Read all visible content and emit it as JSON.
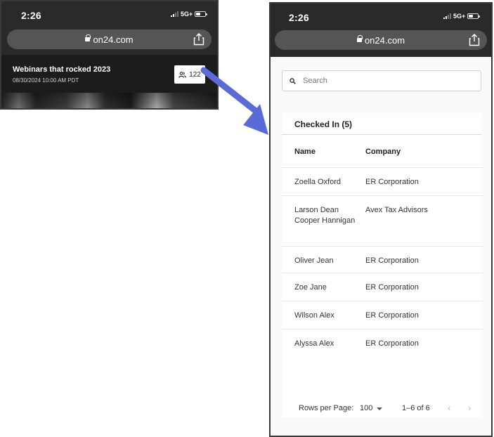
{
  "left_phone": {
    "status": {
      "time": "2:26",
      "network": "5G+"
    },
    "browser": {
      "url": "on24.com"
    },
    "webinar": {
      "title": "Webinars that rocked 2023",
      "date": "08/30/2024 10:00 AM PDT",
      "attendee_count": "122"
    }
  },
  "right_phone": {
    "status": {
      "time": "2:26",
      "network": "5G+"
    },
    "browser": {
      "url": "on24.com"
    },
    "search": {
      "placeholder": "Search"
    },
    "checked_in": {
      "title": "Checked In (5)",
      "columns": {
        "name": "Name",
        "company": "Company"
      },
      "rows": [
        {
          "name": "Zoella Oxford",
          "company": "ER Corporation"
        },
        {
          "name": "Larson Dean Cooper Hannigan",
          "company": "Avex Tax Advisors"
        },
        {
          "name": "Oliver Jean",
          "company": "ER Corporation"
        },
        {
          "name": "Zoe Jane",
          "company": "ER Corporation"
        },
        {
          "name": "Wilson Alex",
          "company": "ER Corporation"
        },
        {
          "name": "Alyssa Alex",
          "company": "ER Corporation"
        }
      ]
    },
    "pagination": {
      "rows_per_page_label": "Rows per Page:",
      "rows_per_page_value": "100",
      "range": "1–6 of 6",
      "prev": "‹",
      "next": "›"
    }
  },
  "colors": {
    "arrow": "#5a6bd8",
    "phone_frame": "#2a2a2a"
  }
}
